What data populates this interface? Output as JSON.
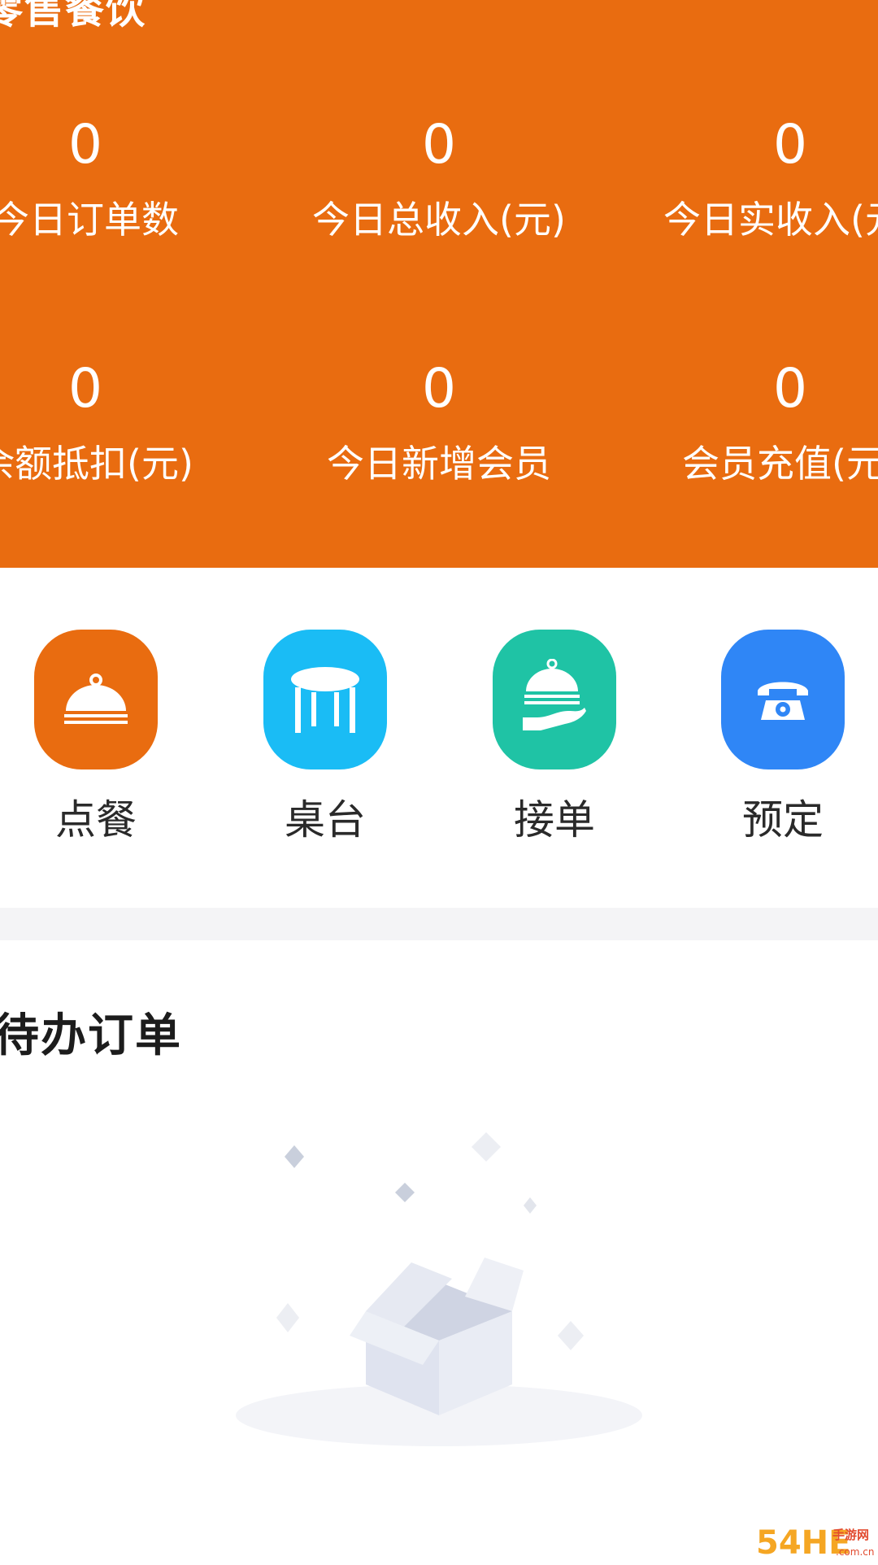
{
  "header": {
    "title": "零售餐饮",
    "stats": [
      {
        "value": "0",
        "label": "今日订单数"
      },
      {
        "value": "0",
        "label": "今日总收入(元)"
      },
      {
        "value": "0",
        "label": "今日实收入(元)"
      },
      {
        "value": "0",
        "label": "余额抵扣(元)"
      },
      {
        "value": "0",
        "label": "今日新增会员"
      },
      {
        "value": "0",
        "label": "会员充值(元)"
      }
    ]
  },
  "actions": [
    {
      "label": "点餐",
      "icon": "cloche-icon",
      "color": "#E96C10"
    },
    {
      "label": "桌台",
      "icon": "table-icon",
      "color": "#1ABCF5"
    },
    {
      "label": "接单",
      "icon": "serving-hand-icon",
      "color": "#1FC3A5"
    },
    {
      "label": "预定",
      "icon": "telephone-icon",
      "color": "#2F86F6"
    }
  ],
  "pending": {
    "title": "待办订单"
  },
  "watermark": {
    "text": "54HE手游网"
  }
}
